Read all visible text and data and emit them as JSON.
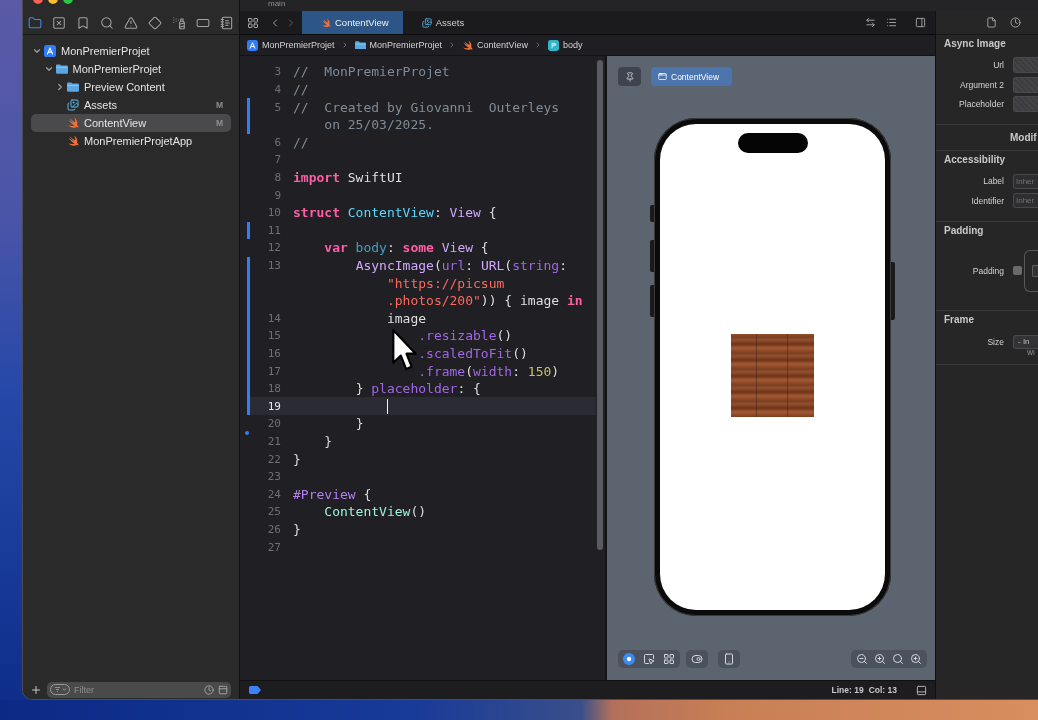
{
  "window": {
    "branch": "main"
  },
  "navigator": {
    "tabs": [
      {
        "kind": "files",
        "selected": true
      },
      {
        "kind": "source-control",
        "selected": false
      },
      {
        "kind": "bookmarks",
        "selected": false
      },
      {
        "kind": "find",
        "selected": false
      },
      {
        "kind": "issues",
        "selected": false
      },
      {
        "kind": "tests",
        "selected": false
      },
      {
        "kind": "debug",
        "selected": false
      },
      {
        "kind": "breakpoints",
        "selected": false
      },
      {
        "kind": "reports",
        "selected": false
      }
    ],
    "tree": [
      {
        "label": "MonPremierProjet",
        "kind": "project",
        "expanded": true,
        "selected": false,
        "children": [
          {
            "label": "MonPremierProjet",
            "kind": "folder",
            "expanded": true,
            "selected": false,
            "children": [
              {
                "label": "Preview Content",
                "kind": "folder",
                "expanded": false,
                "selected": false
              },
              {
                "label": "Assets",
                "kind": "assets",
                "badge": "M",
                "selected": false
              },
              {
                "label": "ContentView",
                "kind": "swift",
                "badge": "M",
                "selected": true
              },
              {
                "label": "MonPremierProjetApp",
                "kind": "swift",
                "selected": false
              }
            ]
          }
        ]
      }
    ],
    "filter": {
      "placeholder": "Filter"
    }
  },
  "editor": {
    "tabs": [
      {
        "label": "ContentView",
        "kind": "swift",
        "selected": true
      },
      {
        "label": "Assets",
        "kind": "assets",
        "selected": false
      }
    ],
    "breadcrumb": [
      {
        "label": "MonPremierProjet",
        "kind": "project"
      },
      {
        "label": "MonPremierProjet",
        "kind": "folder"
      },
      {
        "label": "ContentView",
        "kind": "swift"
      },
      {
        "label": "body",
        "kind": "property"
      }
    ],
    "lines": [
      {
        "number": "3",
        "modified": false,
        "deletion": false,
        "current": false,
        "visual_lines": [
          {
            "tokens": [
              {
                "text": "//  MonPremierProjet",
                "kind": "comment"
              }
            ]
          }
        ]
      },
      {
        "number": "4",
        "modified": false,
        "deletion": false,
        "current": false,
        "visual_lines": [
          {
            "tokens": [
              {
                "text": "//",
                "kind": "comment"
              }
            ]
          }
        ]
      },
      {
        "number": "5",
        "modified": true,
        "deletion": false,
        "current": false,
        "visual_lines": [
          {
            "tokens": [
              {
                "text": "//  Created by Giovanni  Outerleys",
                "kind": "comment"
              }
            ]
          },
          {
            "tokens": [
              {
                "text": "    on 25/03/2025.",
                "kind": "comment"
              }
            ]
          }
        ]
      },
      {
        "number": "6",
        "modified": false,
        "deletion": false,
        "current": false,
        "visual_lines": [
          {
            "tokens": [
              {
                "text": "//",
                "kind": "comment"
              }
            ]
          }
        ]
      },
      {
        "number": "7",
        "modified": false,
        "deletion": false,
        "current": false
      },
      {
        "number": "8",
        "modified": false,
        "deletion": false,
        "current": false,
        "visual_lines": [
          {
            "tokens": [
              {
                "text": "import",
                "kind": "keyword"
              },
              {
                "text": " SwiftUI",
                "kind": "plain"
              }
            ]
          }
        ]
      },
      {
        "number": "9",
        "modified": false,
        "deletion": false,
        "current": false
      },
      {
        "number": "10",
        "modified": false,
        "deletion": false,
        "current": false,
        "visual_lines": [
          {
            "tokens": [
              {
                "text": "struct",
                "kind": "keyword"
              },
              {
                "text": " ContentView",
                "kind": "decl"
              },
              {
                "text": ": ",
                "kind": "plain"
              },
              {
                "text": "View",
                "kind": "type"
              },
              {
                "text": " {",
                "kind": "plain"
              }
            ]
          }
        ]
      },
      {
        "number": "11",
        "modified": true,
        "deletion": false,
        "current": false
      },
      {
        "number": "12",
        "modified": false,
        "deletion": false,
        "current": false,
        "visual_lines": [
          {
            "tokens": [
              {
                "text": "    var",
                "kind": "keyword"
              },
              {
                "text": " body",
                "kind": "local"
              },
              {
                "text": ": ",
                "kind": "plain"
              },
              {
                "text": "some",
                "kind": "keyword"
              },
              {
                "text": " View",
                "kind": "type"
              },
              {
                "text": " {",
                "kind": "plain"
              }
            ]
          }
        ]
      },
      {
        "number": "13",
        "modified": true,
        "deletion": false,
        "current": false,
        "visual_lines": [
          {
            "tokens": [
              {
                "text": "        AsyncImage",
                "kind": "type"
              },
              {
                "text": "(",
                "kind": "plain"
              },
              {
                "text": "url",
                "kind": "method"
              },
              {
                "text": ": ",
                "kind": "plain"
              },
              {
                "text": "URL",
                "kind": "type"
              },
              {
                "text": "(",
                "kind": "plain"
              },
              {
                "text": "string",
                "kind": "method"
              },
              {
                "text": ":",
                "kind": "plain"
              }
            ]
          },
          {
            "tokens": [
              {
                "text": "            \"https://picsum",
                "kind": "string"
              }
            ]
          },
          {
            "tokens": [
              {
                "text": "            .photos/200\"",
                "kind": "string"
              },
              {
                "text": ")) { image ",
                "kind": "plain"
              },
              {
                "text": "in",
                "kind": "keyword"
              }
            ]
          }
        ]
      },
      {
        "number": "14",
        "modified": true,
        "deletion": false,
        "current": false,
        "visual_lines": [
          {
            "tokens": [
              {
                "text": "            image",
                "kind": "plain"
              }
            ]
          }
        ]
      },
      {
        "number": "15",
        "modified": true,
        "deletion": false,
        "current": false,
        "visual_lines": [
          {
            "tokens": [
              {
                "text": "                .resizable",
                "kind": "method"
              },
              {
                "text": "()",
                "kind": "plain"
              }
            ]
          }
        ]
      },
      {
        "number": "16",
        "modified": true,
        "deletion": false,
        "current": false,
        "visual_lines": [
          {
            "tokens": [
              {
                "text": "                .scaledToFit",
                "kind": "method"
              },
              {
                "text": "()",
                "kind": "plain"
              }
            ]
          }
        ]
      },
      {
        "number": "17",
        "modified": true,
        "deletion": false,
        "current": false,
        "visual_lines": [
          {
            "tokens": [
              {
                "text": "                .frame",
                "kind": "method"
              },
              {
                "text": "(",
                "kind": "plain"
              },
              {
                "text": "width",
                "kind": "method"
              },
              {
                "text": ": ",
                "kind": "plain"
              },
              {
                "text": "150",
                "kind": "number"
              },
              {
                "text": ")",
                "kind": "plain"
              }
            ]
          }
        ]
      },
      {
        "number": "18",
        "modified": true,
        "deletion": false,
        "current": false,
        "visual_lines": [
          {
            "tokens": [
              {
                "text": "        }",
                "kind": "plain"
              },
              {
                "text": " placeholder",
                "kind": "method"
              },
              {
                "text": ": {",
                "kind": "plain"
              }
            ]
          }
        ]
      },
      {
        "number": "19",
        "modified": true,
        "deletion": false,
        "current": true
      },
      {
        "number": "20",
        "modified": false,
        "deletion": false,
        "current": false,
        "visual_lines": [
          {
            "tokens": [
              {
                "text": "        }",
                "kind": "plain"
              }
            ]
          }
        ]
      },
      {
        "number": "21",
        "modified": false,
        "deletion": true,
        "current": false,
        "visual_lines": [
          {
            "tokens": [
              {
                "text": "    }",
                "kind": "plain"
              }
            ]
          }
        ]
      },
      {
        "number": "22",
        "modified": false,
        "deletion": false,
        "current": false,
        "visual_lines": [
          {
            "tokens": [
              {
                "text": "}",
                "kind": "plain"
              }
            ]
          }
        ]
      },
      {
        "number": "23",
        "modified": false,
        "deletion": false,
        "current": false
      },
      {
        "number": "24",
        "modified": false,
        "deletion": false,
        "current": false,
        "visual_lines": [
          {
            "tokens": [
              {
                "text": "#Preview",
                "kind": "macro"
              },
              {
                "text": " {",
                "kind": "plain"
              }
            ]
          }
        ]
      },
      {
        "number": "25",
        "modified": false,
        "deletion": false,
        "current": false,
        "visual_lines": [
          {
            "tokens": [
              {
                "text": "    ContentView",
                "kind": "project"
              },
              {
                "text": "()",
                "kind": "plain"
              }
            ]
          }
        ]
      },
      {
        "number": "26",
        "modified": false,
        "deletion": false,
        "current": false,
        "visual_lines": [
          {
            "tokens": [
              {
                "text": "}",
                "kind": "plain"
              }
            ]
          }
        ]
      },
      {
        "number": "27",
        "modified": false,
        "deletion": false,
        "current": false
      }
    ]
  },
  "canvas": {
    "preview_label": "ContentView",
    "modes": [
      {
        "kind": "live",
        "selected": true
      },
      {
        "kind": "select",
        "selected": false
      },
      {
        "kind": "grid",
        "selected": false
      }
    ]
  },
  "status_bar": {
    "line": "Line: 19",
    "column": "Col: 13"
  },
  "inspector": {
    "sections": [
      {
        "kind": "fields",
        "title": "Async Image",
        "rows": [
          {
            "label": "Url"
          },
          {
            "label": "Argument 2"
          },
          {
            "label": "Placeholder"
          }
        ]
      },
      {
        "kind": "heading",
        "title": "Modif"
      },
      {
        "kind": "fields",
        "title": "Accessibility",
        "rows": [
          {
            "label": "Label",
            "placeholder": "Inher"
          },
          {
            "label": "Identifier",
            "placeholder": "Inher"
          }
        ]
      },
      {
        "kind": "padding",
        "title": "Padding",
        "label": "Padding",
        "checked": false
      },
      {
        "kind": "frame",
        "title": "Frame",
        "label": "Size",
        "value": "- In",
        "caption": "Wi"
      }
    ]
  }
}
